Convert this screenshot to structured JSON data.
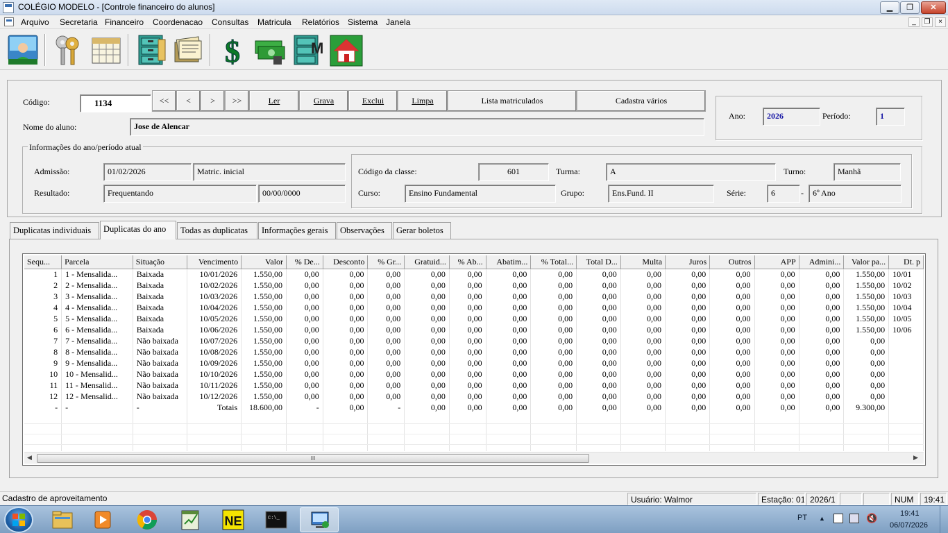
{
  "window": {
    "title": "COLÉGIO MODELO - [Controle financeiro do alunos]",
    "min": "▁",
    "max": "❐",
    "close": "✕"
  },
  "menu": [
    "Arquivo",
    "Secretaria",
    "Financeiro",
    "Coordenacao",
    "Consultas",
    "Matricula",
    "Relatórios",
    "Sistema",
    "Janela"
  ],
  "mdi": {
    "min": "_",
    "max": "❐",
    "close": "×"
  },
  "toolbar_icons": [
    "users-icon",
    "keys-icon",
    "calendar-icon",
    "file-cabinet-icon",
    "documents-icon",
    "dollar-icon",
    "money-icon",
    "cabinet-m-icon",
    "home-icon"
  ],
  "form": {
    "codigo_label": "Código:",
    "codigo_value": "1134",
    "nav": [
      "<<",
      "<",
      ">",
      ">>"
    ],
    "buttons": [
      "Ler",
      "Grava",
      "Exclui",
      "Limpa",
      "Lista matriculados",
      "Cadastra vários"
    ],
    "nome_label": "Nome do aluno:",
    "nome_value": "Jose de Alencar",
    "ano_label": "Ano:",
    "ano_value": "2026",
    "periodo_label": "Período:",
    "periodo_value": "1",
    "info_group_title": "Informações do ano/período atual",
    "admissao_label": "Admissão:",
    "admissao_value": "01/02/2026",
    "admissao_tipo": "Matric. inicial",
    "resultado_label": "Resultado:",
    "resultado_value": "Frequentando",
    "resultado_data": "00/00/0000",
    "classe_label": "Código da classe:",
    "classe_value": "601",
    "turma_label": "Turma:",
    "turma_value": "A",
    "turno_label": "Turno:",
    "turno_value": "Manhã",
    "curso_label": "Curso:",
    "curso_value": "Ensino Fundamental",
    "grupo_label": "Grupo:",
    "grupo_value": "Ens.Fund. II",
    "serie_label": "Série:",
    "serie_value": "6",
    "serie_dash": "-",
    "serie_desc": "6º Ano"
  },
  "tabs": [
    "Duplicatas individuais",
    "Duplicatas do ano",
    "Todas as duplicatas",
    "Informações gerais",
    "Observações",
    "Gerar boletos"
  ],
  "grid": {
    "columns": [
      "Sequ...",
      "Parcela",
      "Situação",
      "Vencimento",
      "Valor",
      "% De...",
      "Desconto",
      "% Gr...",
      "Gratuid...",
      "% Ab...",
      "Abatim...",
      "% Total...",
      "Total D...",
      "Multa",
      "Juros",
      "Outros",
      "APP",
      "Admini...",
      "Valor pa...",
      "Dt. p"
    ],
    "rows": [
      [
        "1",
        "1 - Mensalida...",
        "Baixada",
        "10/01/2026",
        "1.550,00",
        "0,00",
        "0,00",
        "0,00",
        "0,00",
        "0,00",
        "0,00",
        "0,00",
        "0,00",
        "0,00",
        "0,00",
        "0,00",
        "0,00",
        "0,00",
        "1.550,00",
        "10/01"
      ],
      [
        "2",
        "2 - Mensalida...",
        "Baixada",
        "10/02/2026",
        "1.550,00",
        "0,00",
        "0,00",
        "0,00",
        "0,00",
        "0,00",
        "0,00",
        "0,00",
        "0,00",
        "0,00",
        "0,00",
        "0,00",
        "0,00",
        "0,00",
        "1.550,00",
        "10/02"
      ],
      [
        "3",
        "3 - Mensalida...",
        "Baixada",
        "10/03/2026",
        "1.550,00",
        "0,00",
        "0,00",
        "0,00",
        "0,00",
        "0,00",
        "0,00",
        "0,00",
        "0,00",
        "0,00",
        "0,00",
        "0,00",
        "0,00",
        "0,00",
        "1.550,00",
        "10/03"
      ],
      [
        "4",
        "4 - Mensalida...",
        "Baixada",
        "10/04/2026",
        "1.550,00",
        "0,00",
        "0,00",
        "0,00",
        "0,00",
        "0,00",
        "0,00",
        "0,00",
        "0,00",
        "0,00",
        "0,00",
        "0,00",
        "0,00",
        "0,00",
        "1.550,00",
        "10/04"
      ],
      [
        "5",
        "5 - Mensalida...",
        "Baixada",
        "10/05/2026",
        "1.550,00",
        "0,00",
        "0,00",
        "0,00",
        "0,00",
        "0,00",
        "0,00",
        "0,00",
        "0,00",
        "0,00",
        "0,00",
        "0,00",
        "0,00",
        "0,00",
        "1.550,00",
        "10/05"
      ],
      [
        "6",
        "6 - Mensalida...",
        "Baixada",
        "10/06/2026",
        "1.550,00",
        "0,00",
        "0,00",
        "0,00",
        "0,00",
        "0,00",
        "0,00",
        "0,00",
        "0,00",
        "0,00",
        "0,00",
        "0,00",
        "0,00",
        "0,00",
        "1.550,00",
        "10/06"
      ],
      [
        "7",
        "7 - Mensalida...",
        "Não baixada",
        "10/07/2026",
        "1.550,00",
        "0,00",
        "0,00",
        "0,00",
        "0,00",
        "0,00",
        "0,00",
        "0,00",
        "0,00",
        "0,00",
        "0,00",
        "0,00",
        "0,00",
        "0,00",
        "0,00",
        ""
      ],
      [
        "8",
        "8 - Mensalida...",
        "Não baixada",
        "10/08/2026",
        "1.550,00",
        "0,00",
        "0,00",
        "0,00",
        "0,00",
        "0,00",
        "0,00",
        "0,00",
        "0,00",
        "0,00",
        "0,00",
        "0,00",
        "0,00",
        "0,00",
        "0,00",
        ""
      ],
      [
        "9",
        "9 - Mensalida...",
        "Não baixada",
        "10/09/2026",
        "1.550,00",
        "0,00",
        "0,00",
        "0,00",
        "0,00",
        "0,00",
        "0,00",
        "0,00",
        "0,00",
        "0,00",
        "0,00",
        "0,00",
        "0,00",
        "0,00",
        "0,00",
        ""
      ],
      [
        "10",
        "10 - Mensalid...",
        "Não baixada",
        "10/10/2026",
        "1.550,00",
        "0,00",
        "0,00",
        "0,00",
        "0,00",
        "0,00",
        "0,00",
        "0,00",
        "0,00",
        "0,00",
        "0,00",
        "0,00",
        "0,00",
        "0,00",
        "0,00",
        ""
      ],
      [
        "11",
        "11 - Mensalid...",
        "Não baixada",
        "10/11/2026",
        "1.550,00",
        "0,00",
        "0,00",
        "0,00",
        "0,00",
        "0,00",
        "0,00",
        "0,00",
        "0,00",
        "0,00",
        "0,00",
        "0,00",
        "0,00",
        "0,00",
        "0,00",
        ""
      ],
      [
        "12",
        "12 - Mensalid...",
        "Não baixada",
        "10/12/2026",
        "1.550,00",
        "0,00",
        "0,00",
        "0,00",
        "0,00",
        "0,00",
        "0,00",
        "0,00",
        "0,00",
        "0,00",
        "0,00",
        "0,00",
        "0,00",
        "0,00",
        "0,00",
        ""
      ],
      [
        "-",
        "-",
        "-",
        "Totais",
        "18.600,00",
        "-",
        "0,00",
        "-",
        "0,00",
        "0,00",
        "0,00",
        "0,00",
        "0,00",
        "0,00",
        "0,00",
        "0,00",
        "0,00",
        "0,00",
        "9.300,00",
        ""
      ]
    ],
    "scroll_grip": "III"
  },
  "status": {
    "message": "Cadastro de aproveitamento",
    "usuario": "Usuário: Walmor",
    "estacao": "Estação: 01",
    "periodo": "2026/1",
    "num": "NUM",
    "hora": "19:41"
  },
  "taskbar": {
    "lang": "PT",
    "time": "19:41",
    "date": "06/07/2026",
    "apps": [
      "explorer-icon",
      "media-player-icon",
      "chrome-icon",
      "notepad-icon",
      "ne-icon",
      "cmd-icon",
      "school-app-icon"
    ]
  },
  "colors": {
    "accent_blue": "#1a1aa6",
    "title_bg": "#dfe9f5",
    "taskbar": "#8fb0d3"
  }
}
